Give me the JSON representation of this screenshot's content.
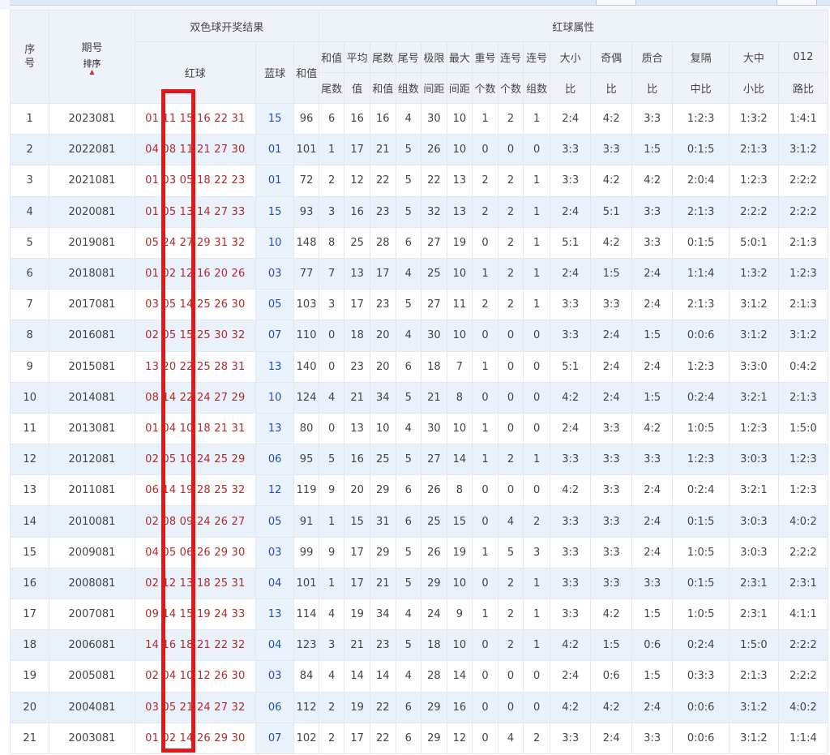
{
  "header": {
    "seq_label_line1": "序",
    "seq_label_line2": "号",
    "issue_label": "期号",
    "sort_label": "排序",
    "result_group": "双色球开奖结果",
    "red_ball": "红球",
    "blue_ball": "蓝球",
    "sum": "和值",
    "attr_group": "红球属性",
    "cols": [
      {
        "l1": "和值",
        "l2": "尾数"
      },
      {
        "l1": "平均",
        "l2": "值"
      },
      {
        "l1": "尾数",
        "l2": "和值"
      },
      {
        "l1": "尾号",
        "l2": "组数"
      },
      {
        "l1": "极限",
        "l2": "间距"
      },
      {
        "l1": "最大",
        "l2": "间距"
      },
      {
        "l1": "重号",
        "l2": "个数"
      },
      {
        "l1": "连号",
        "l2": "个数"
      },
      {
        "l1": "连号",
        "l2": "组数"
      },
      {
        "l1": "大小",
        "l2": "比"
      },
      {
        "l1": "奇偶",
        "l2": "比"
      },
      {
        "l1": "质合",
        "l2": "比"
      },
      {
        "l1": "复隔",
        "l2": "中比"
      },
      {
        "l1": "大中",
        "l2": "小比"
      },
      {
        "l1": "012",
        "l2": "路比"
      }
    ]
  },
  "rows": [
    {
      "seq": "1",
      "issue": "2023081",
      "red": "01 11 15 16 22 31",
      "blue": "15",
      "v": [
        "96",
        "6",
        "16",
        "16",
        "4",
        "30",
        "10",
        "1",
        "2",
        "1",
        "2:4",
        "4:2",
        "3:3",
        "1:2:3",
        "1:3:2",
        "1:4:1"
      ]
    },
    {
      "seq": "2",
      "issue": "2022081",
      "red": "04 08 11 21 27 30",
      "blue": "01",
      "v": [
        "101",
        "1",
        "17",
        "21",
        "5",
        "26",
        "10",
        "0",
        "0",
        "0",
        "3:3",
        "3:3",
        "1:5",
        "0:1:5",
        "2:1:3",
        "3:1:2"
      ]
    },
    {
      "seq": "3",
      "issue": "2021081",
      "red": "01 03 05 18 22 23",
      "blue": "01",
      "v": [
        "72",
        "2",
        "12",
        "22",
        "5",
        "22",
        "13",
        "2",
        "2",
        "1",
        "3:3",
        "4:2",
        "4:2",
        "2:0:4",
        "1:2:3",
        "2:2:2"
      ]
    },
    {
      "seq": "4",
      "issue": "2020081",
      "red": "01 05 13 14 27 33",
      "blue": "15",
      "v": [
        "93",
        "3",
        "16",
        "23",
        "5",
        "32",
        "13",
        "2",
        "2",
        "1",
        "2:4",
        "5:1",
        "3:3",
        "2:1:3",
        "2:2:2",
        "2:2:2"
      ]
    },
    {
      "seq": "5",
      "issue": "2019081",
      "red": "05 24 27 29 31 32",
      "blue": "10",
      "v": [
        "148",
        "8",
        "25",
        "28",
        "6",
        "27",
        "19",
        "0",
        "2",
        "1",
        "5:1",
        "4:2",
        "3:3",
        "0:1:5",
        "5:0:1",
        "2:1:3"
      ]
    },
    {
      "seq": "6",
      "issue": "2018081",
      "red": "01 02 12 16 20 26",
      "blue": "03",
      "v": [
        "77",
        "7",
        "13",
        "17",
        "4",
        "25",
        "10",
        "1",
        "2",
        "1",
        "2:4",
        "1:5",
        "2:4",
        "1:1:4",
        "1:3:2",
        "1:2:3"
      ]
    },
    {
      "seq": "7",
      "issue": "2017081",
      "red": "03 05 14 25 26 30",
      "blue": "05",
      "v": [
        "103",
        "3",
        "17",
        "23",
        "5",
        "27",
        "11",
        "2",
        "2",
        "1",
        "3:3",
        "3:3",
        "2:4",
        "2:1:3",
        "3:1:2",
        "2:1:3"
      ]
    },
    {
      "seq": "8",
      "issue": "2016081",
      "red": "02 05 15 25 30 32",
      "blue": "07",
      "v": [
        "110",
        "0",
        "18",
        "20",
        "4",
        "30",
        "10",
        "0",
        "0",
        "0",
        "3:3",
        "2:4",
        "1:5",
        "0:0:6",
        "3:1:2",
        "3:1:2"
      ]
    },
    {
      "seq": "9",
      "issue": "2015081",
      "red": "13 20 22 25 28 31",
      "blue": "13",
      "v": [
        "140",
        "0",
        "23",
        "20",
        "6",
        "18",
        "7",
        "1",
        "0",
        "0",
        "5:1",
        "2:4",
        "2:4",
        "1:2:3",
        "3:3:0",
        "0:4:2"
      ]
    },
    {
      "seq": "10",
      "issue": "2014081",
      "red": "08 14 22 24 27 29",
      "blue": "10",
      "v": [
        "124",
        "4",
        "21",
        "34",
        "5",
        "21",
        "8",
        "0",
        "0",
        "0",
        "4:2",
        "2:4",
        "1:5",
        "0:2:4",
        "3:2:1",
        "2:1:3"
      ]
    },
    {
      "seq": "11",
      "issue": "2013081",
      "red": "01 04 10 18 21 31",
      "blue": "13",
      "v": [
        "80",
        "0",
        "13",
        "10",
        "4",
        "30",
        "10",
        "1",
        "0",
        "0",
        "2:4",
        "3:3",
        "4:2",
        "1:0:5",
        "1:2:3",
        "1:5:0"
      ]
    },
    {
      "seq": "12",
      "issue": "2012081",
      "red": "02 05 10 24 25 29",
      "blue": "06",
      "v": [
        "95",
        "5",
        "16",
        "25",
        "5",
        "27",
        "14",
        "1",
        "2",
        "1",
        "3:3",
        "3:3",
        "3:3",
        "1:2:3",
        "3:0:3",
        "1:2:3"
      ]
    },
    {
      "seq": "13",
      "issue": "2011081",
      "red": "06 14 19 28 25 32",
      "blue": "12",
      "v": [
        "119",
        "9",
        "20",
        "29",
        "6",
        "26",
        "8",
        "0",
        "0",
        "0",
        "4:2",
        "3:3",
        "2:4",
        "0:2:4",
        "3:2:1",
        "1:2:3"
      ]
    },
    {
      "seq": "14",
      "issue": "2010081",
      "red": "02 08 09 24 26 27",
      "blue": "05",
      "v": [
        "91",
        "1",
        "15",
        "31",
        "6",
        "25",
        "15",
        "0",
        "4",
        "2",
        "3:3",
        "3:3",
        "2:4",
        "0:1:5",
        "3:0:3",
        "4:0:2"
      ]
    },
    {
      "seq": "15",
      "issue": "2009081",
      "red": "04 05 06 26 29 30",
      "blue": "03",
      "v": [
        "99",
        "9",
        "17",
        "29",
        "5",
        "26",
        "19",
        "1",
        "5",
        "3",
        "3:3",
        "3:3",
        "2:4",
        "1:0:5",
        "3:0:3",
        "2:2:2"
      ]
    },
    {
      "seq": "16",
      "issue": "2008081",
      "red": "02 12 13 18 25 31",
      "blue": "04",
      "v": [
        "101",
        "1",
        "17",
        "21",
        "5",
        "29",
        "10",
        "0",
        "2",
        "1",
        "3:3",
        "3:3",
        "3:3",
        "0:1:5",
        "2:3:1",
        "2:3:1"
      ]
    },
    {
      "seq": "17",
      "issue": "2007081",
      "red": "09 14 15 19 24 33",
      "blue": "13",
      "v": [
        "114",
        "4",
        "19",
        "34",
        "4",
        "24",
        "9",
        "1",
        "2",
        "1",
        "3:3",
        "4:2",
        "1:5",
        "1:0:5",
        "2:3:1",
        "4:1:1"
      ]
    },
    {
      "seq": "18",
      "issue": "2006081",
      "red": "14 16 18 21 22 32",
      "blue": "04",
      "v": [
        "123",
        "3",
        "21",
        "23",
        "5",
        "18",
        "10",
        "0",
        "2",
        "1",
        "4:2",
        "1:5",
        "0:6",
        "0:2:4",
        "1:5:0",
        "2:2:2"
      ]
    },
    {
      "seq": "19",
      "issue": "2005081",
      "red": "02 04 10 12 26 30",
      "blue": "03",
      "v": [
        "84",
        "4",
        "14",
        "14",
        "4",
        "28",
        "14",
        "0",
        "0",
        "0",
        "2:4",
        "0:6",
        "1:5",
        "0:3:3",
        "2:1:3",
        "2:2:2"
      ]
    },
    {
      "seq": "20",
      "issue": "2004081",
      "red": "03 05 21 24 27 32",
      "blue": "06",
      "v": [
        "112",
        "2",
        "19",
        "22",
        "6",
        "29",
        "16",
        "0",
        "0",
        "0",
        "4:2",
        "4:2",
        "2:4",
        "0:0:6",
        "3:1:2",
        "4:0:2"
      ]
    },
    {
      "seq": "21",
      "issue": "2003081",
      "red": "01 02 14 26 29 30",
      "blue": "07",
      "v": [
        "102",
        "2",
        "17",
        "22",
        "6",
        "29",
        "12",
        "0",
        "4",
        "2",
        "3:3",
        "2:4",
        "3:3",
        "0:0:6",
        "3:1:2",
        "1:1:4"
      ]
    }
  ],
  "colors": {
    "red_text": "#b32a2a",
    "blue_text": "#1f4fb5",
    "highlight": "#e01a1a",
    "row_alt": "#e9f2fb",
    "header_bg": "#eef3f9"
  }
}
